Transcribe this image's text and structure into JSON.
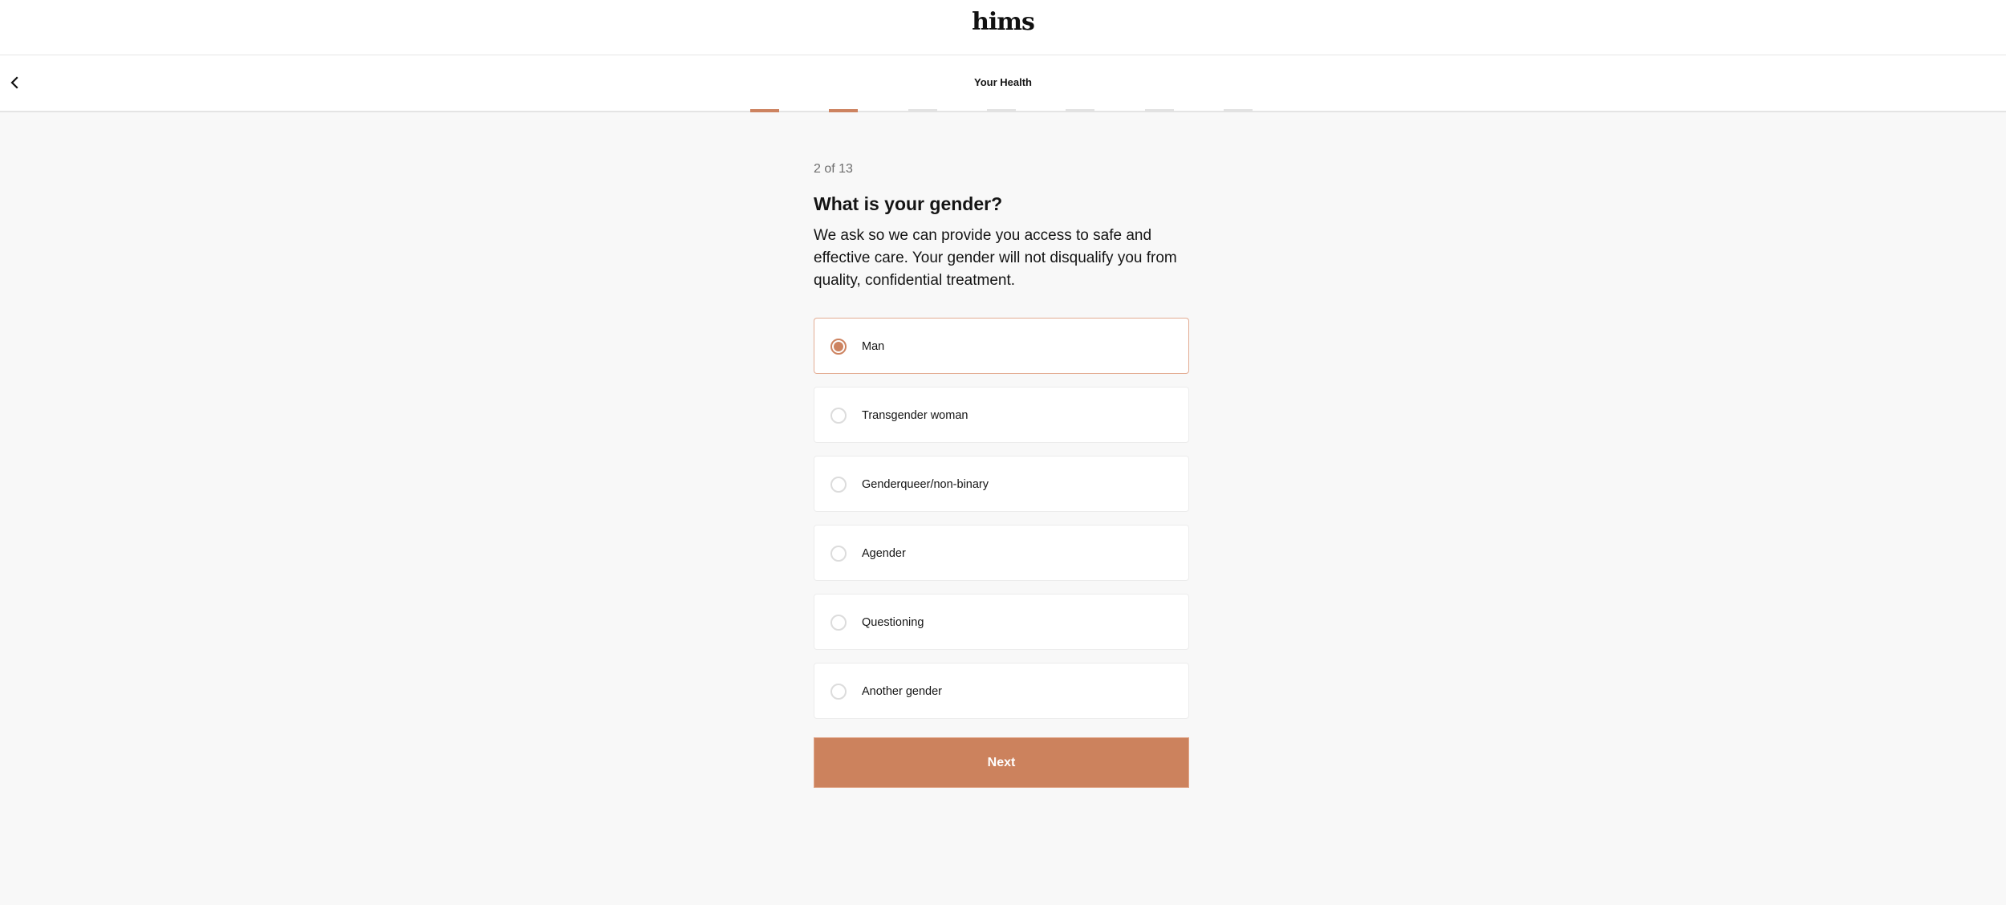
{
  "header": {
    "logo": "hims",
    "back_icon": "chevron-left-icon",
    "section_title": "Your Health"
  },
  "progress": {
    "total_segments": 7,
    "completed_segments": 2,
    "active_color": "#cd8360",
    "inactive_color": "#e2e2e2"
  },
  "question": {
    "step": "2 of 13",
    "title": "What is your gender?",
    "description": "We ask so we can provide you access to safe and effective care. Your gender will not disqualify you from quality, confidential treatment."
  },
  "options": [
    {
      "label": "Man",
      "selected": true
    },
    {
      "label": "Transgender woman",
      "selected": false
    },
    {
      "label": "Genderqueer/non-binary",
      "selected": false
    },
    {
      "label": "Agender",
      "selected": false
    },
    {
      "label": "Questioning",
      "selected": false
    },
    {
      "label": "Another gender",
      "selected": false
    }
  ],
  "actions": {
    "next_label": "Next",
    "accent_color": "#cc825d"
  }
}
